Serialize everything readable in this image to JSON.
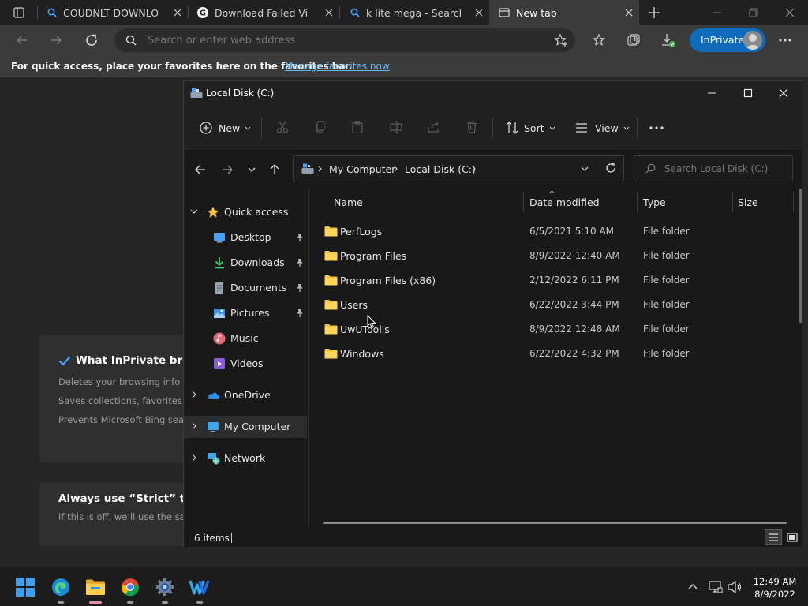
{
  "browser": {
    "tabs": [
      {
        "title": "COUDNLT DOWNLOAD",
        "active": false
      },
      {
        "title": "Download Failed Virus Detected",
        "active": false
      },
      {
        "title": "k lite mega - Search",
        "active": false
      },
      {
        "title": "New tab",
        "active": true
      }
    ],
    "address_placeholder": "Search or enter web address",
    "inprivate_label": "InPrivate",
    "favorites_message": "For quick access, place your favorites here on the favorites bar.",
    "favorites_link": "Manage favorites now"
  },
  "inprivate_page": {
    "card1_title": "What InPrivate browsing does",
    "card1_lines": [
      "Deletes your browsing info when you close all InPrivate windows",
      "Saves collections, favorites, and downloaded files",
      "Prevents Microsoft Bing searches from being associated with you"
    ],
    "card2_title": "Always use “Strict” tracking prevention",
    "card2_line": "If this is off, we’ll use the same setting as in normal browsing"
  },
  "explorer": {
    "title": "Local Disk (C:)",
    "toolbar": {
      "new_label": "New",
      "sort_label": "Sort",
      "view_label": "View"
    },
    "breadcrumb": [
      "My Computer",
      "Local Disk (C:)"
    ],
    "search_placeholder": "Search Local Disk (C:)",
    "nav": [
      {
        "label": "Quick access",
        "icon": "star-icon",
        "pinned": false
      },
      {
        "label": "Desktop",
        "icon": "desktop-icon",
        "pinned": true
      },
      {
        "label": "Downloads",
        "icon": "download-arrow-icon",
        "pinned": true
      },
      {
        "label": "Documents",
        "icon": "document-icon",
        "pinned": true
      },
      {
        "label": "Pictures",
        "icon": "picture-icon",
        "pinned": true
      },
      {
        "label": "Music",
        "icon": "music-icon",
        "pinned": false
      },
      {
        "label": "Videos",
        "icon": "video-icon",
        "pinned": false
      },
      {
        "label": "OneDrive",
        "icon": "cloud-icon",
        "pinned": false
      },
      {
        "label": "My Computer",
        "icon": "computer-icon",
        "pinned": false,
        "selected": true
      },
      {
        "label": "Network",
        "icon": "network-icon",
        "pinned": false
      }
    ],
    "columns": {
      "name": "Name",
      "date": "Date modified",
      "type": "Type",
      "size": "Size"
    },
    "files": [
      {
        "name": "PerfLogs",
        "date": "6/5/2021 5:10 AM",
        "type": "File folder"
      },
      {
        "name": "Program Files",
        "date": "8/9/2022 12:40 AM",
        "type": "File folder"
      },
      {
        "name": "Program Files (x86)",
        "date": "2/12/2022 6:11 PM",
        "type": "File folder"
      },
      {
        "name": "Users",
        "date": "6/22/2022 3:44 PM",
        "type": "File folder"
      },
      {
        "name": "UwUToolls",
        "date": "8/9/2022 12:48 AM",
        "type": "File folder"
      },
      {
        "name": "Windows",
        "date": "6/22/2022 4:32 PM",
        "type": "File folder"
      }
    ],
    "status_count": "6 items"
  },
  "taskbar": {
    "time": "12:49 AM",
    "date": "8/9/2022",
    "apps": [
      "windows-start-icon",
      "edge-icon",
      "file-explorer-icon",
      "chrome-icon",
      "settings-gear-icon",
      "wondershare-icon"
    ]
  },
  "colors": {
    "accent": "#0f6cbd",
    "folder": "#f4c542",
    "link": "#6cb8ff"
  }
}
